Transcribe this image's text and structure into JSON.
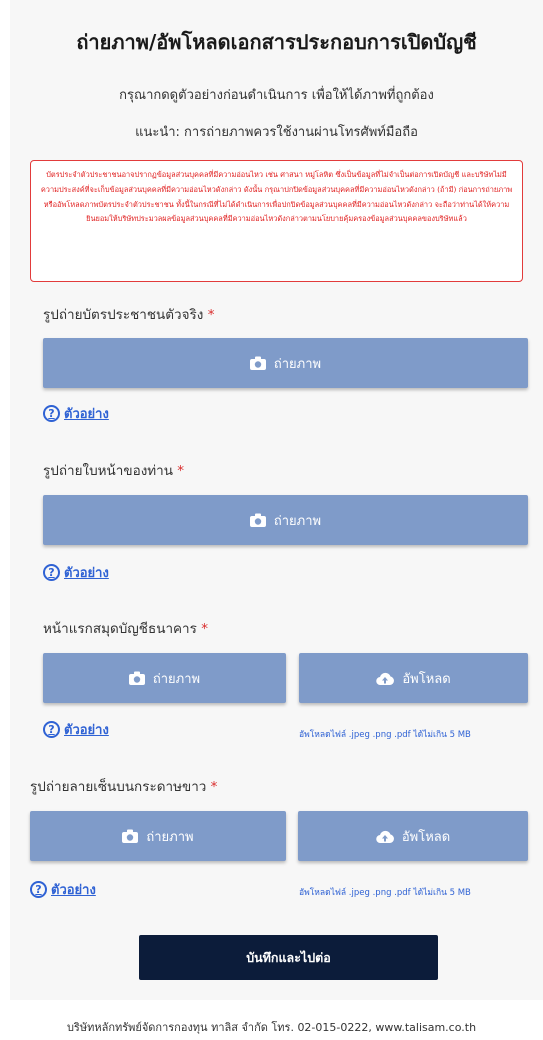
{
  "header": {
    "title": "ถ่ายภาพ/อัพโหลดเอกสารประกอบการเปิดบัญชี",
    "instruction": "กรุณากดดูตัวอย่างก่อนดำเนินการ เพื่อให้ได้ภาพที่ถูกต้อง",
    "recommendation": "แนะนำ: การถ่ายภาพควรใช้งานผ่านโทรศัพท์มือถือ"
  },
  "warning": {
    "text": "บัตรประจำตัวประชาชนอาจปรากฏข้อมูลส่วนบุคคลที่มีความอ่อนไหว เช่น ศาสนา หมู่โลหิต ซึ่งเป็นข้อมูลที่ไม่จำเป็นต่อการเปิดบัญชี และบริษัทไม่มีความประสงค์ที่จะเก็บข้อมูลส่วนบุคคลที่มีความอ่อนไหวดังกล่าว ดังนั้น กรุณาปกปิดข้อมูลส่วนบุคคลที่มีความอ่อนไหวดังกล่าว (ถ้ามี) ก่อนการถ่ายภาพหรืออัพโหลดภาพบัตรประจำตัวประชาชน ทั้งนี้ในกรณีที่ไม่ได้ดำเนินการเพื่อปกปิดข้อมูลส่วนบุคคลที่มีความอ่อนไหวดังกล่าว จะถือว่าท่านได้ให้ความยินยอมให้บริษัทประมวลผลข้อมูลส่วนบุคคลที่มีความอ่อนไหวดังกล่าวตามนโยบายคุ้มครองข้อมูลส่วนบุคคลของบริษัทแล้ว"
  },
  "sections": [
    {
      "label": "รูปถ่ายบัตรประชาชนตัวจริง",
      "required": "*",
      "capture_label": "ถ่ายภาพ",
      "example_label": "ตัวอย่าง"
    },
    {
      "label": "รูปถ่ายใบหน้าของท่าน",
      "required": "*",
      "capture_label": "ถ่ายภาพ",
      "example_label": "ตัวอย่าง"
    },
    {
      "label": "หน้าแรกสมุดบัญชีธนาคาร",
      "required": "*",
      "capture_label": "ถ่ายภาพ",
      "upload_label": "อัพโหลด",
      "example_label": "ตัวอย่าง",
      "file_hint": "อัพโหลดไฟล์ .jpeg .png .pdf ได้ไม่เกิน 5 MB"
    },
    {
      "label": "รูปถ่ายลายเซ็นบนกระดาษขาว",
      "required": "*",
      "capture_label": "ถ่ายภาพ",
      "upload_label": "อัพโหลด",
      "example_label": "ตัวอย่าง",
      "file_hint": "อัพโหลดไฟล์ .jpeg .png .pdf ได้ไม่เกิน 5 MB"
    }
  ],
  "submit": {
    "label": "บันทึกและไปต่อ"
  },
  "footer": {
    "text": "บริษัทหลักทรัพย์จัดการกองทุน ทาลิส จำกัด โทร. 02-015-0222, www.talisam.co.th"
  },
  "colors": {
    "button": "#7f9bc9",
    "submit": "#0c1c3a",
    "link": "#2f62d4",
    "warning": "#e01f1f"
  },
  "icons": {
    "capture": "camera-icon",
    "upload": "cloud-upload-icon",
    "example": "question-circle-icon"
  }
}
